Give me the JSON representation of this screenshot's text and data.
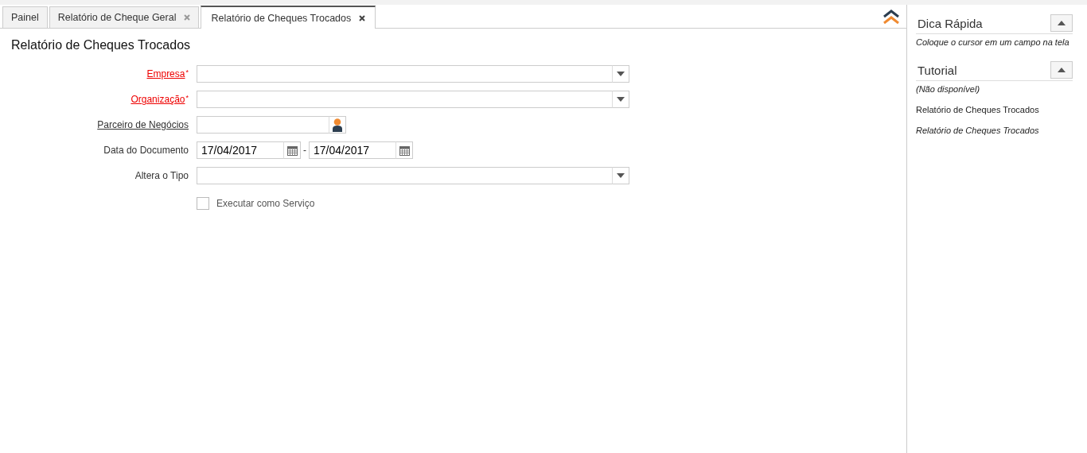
{
  "tabs": [
    {
      "label": "Painel",
      "selected": false,
      "closable": false
    },
    {
      "label": "Relatório de Cheque Geral",
      "selected": false,
      "closable": true
    },
    {
      "label": "Relatório de Cheques Trocados",
      "selected": true,
      "closable": true
    }
  ],
  "form": {
    "title": "Relatório de Cheques Trocados",
    "fields": [
      {
        "kind": "combo",
        "label": "Empresa",
        "required_mark": "*",
        "link": true
      },
      {
        "kind": "combo",
        "label": "Organização",
        "required_mark": "*",
        "link": true
      },
      {
        "kind": "search",
        "label": "Parceiro de Negócios",
        "link": true
      },
      {
        "kind": "daterange",
        "label": "Data do Documento",
        "link": false,
        "from": "17/04/2017",
        "separator": "-",
        "to": "17/04/2017"
      },
      {
        "kind": "combo",
        "label": "Altera o Tipo",
        "link": false
      },
      {
        "kind": "checkbox",
        "label": "Executar como Serviço",
        "checked": false
      }
    ]
  },
  "side_panel": {
    "sections": [
      {
        "title": "Dica Rápida",
        "expanded": true,
        "lines": [
          {
            "text": "Coloque o cursor em um campo na tela",
            "kind": "italic"
          }
        ]
      },
      {
        "title": "Tutorial",
        "expanded": true,
        "lines": [
          {
            "text": "(Não disponível)",
            "kind": "italic"
          },
          {
            "text": "Relatório de Cheques Trocados",
            "kind": "plain"
          },
          {
            "text": "Relatório de Cheques Trocados",
            "kind": "italic"
          }
        ]
      }
    ]
  }
}
